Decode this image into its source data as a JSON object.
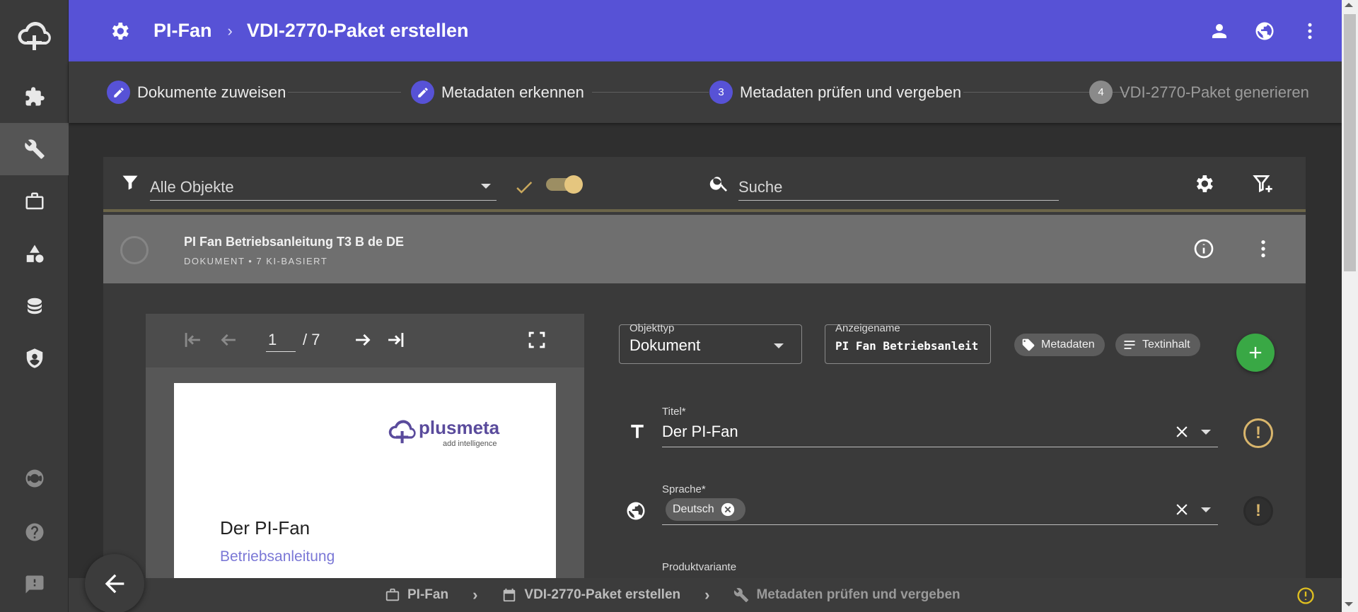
{
  "header": {
    "crumb_app": "PI-Fan",
    "crumb_separator": "›",
    "crumb_page": "VDI-2770-Paket erstellen"
  },
  "sidebar": {
    "items": [
      {
        "icon": "puzzle-icon"
      },
      {
        "icon": "wrench-icon",
        "active": true
      },
      {
        "icon": "briefcase-icon"
      },
      {
        "icon": "shapes-icon"
      },
      {
        "icon": "database-icon"
      },
      {
        "icon": "shield-icon"
      },
      {
        "icon": "lifebuoy-icon"
      },
      {
        "icon": "help-icon"
      },
      {
        "icon": "feedback-icon"
      }
    ]
  },
  "stepper": {
    "steps": [
      {
        "label": "Dokumente zuweisen",
        "state": "done"
      },
      {
        "label": "Metadaten erkennen",
        "state": "done"
      },
      {
        "number": "3",
        "label": "Metadaten prüfen und vergeben",
        "state": "active"
      },
      {
        "number": "4",
        "label": "VDI-2770-Paket generieren",
        "state": "disabled"
      }
    ]
  },
  "toolbar": {
    "filter_value": "Alle Objekte",
    "search_placeholder": "Suche"
  },
  "document": {
    "title": "PI Fan Betriebsanleitung T3 B de DE",
    "subtitle": "DOKUMENT • 7 KI-BASIERT"
  },
  "viewer": {
    "page_current": "1",
    "page_total": "/ 7",
    "page_logo_word": "plusmeta",
    "page_logo_tagline": "add intelligence",
    "page_heading": "Der PI-Fan",
    "page_subheading": "Betriebsanleitung"
  },
  "form": {
    "objecttype_label": "Objekttyp",
    "objecttype_value": "Dokument",
    "displayname_label": "Anzeigename",
    "displayname_value": "PI Fan Betriebsanleit",
    "chip_metadata": "Metadaten",
    "chip_textcontent": "Textinhalt",
    "title_label": "Titel*",
    "title_value": "Der PI-Fan",
    "language_label": "Sprache*",
    "language_chip": "Deutsch",
    "variant_label": "Produktvariante"
  },
  "bottombar": {
    "crumb1": "PI-Fan",
    "crumb2": "VDI-2770-Paket erstellen",
    "crumb3": "Metadaten prüfen und vergeben",
    "separator": "›"
  },
  "colors": {
    "brand": "#5752d6",
    "success": "#39a845",
    "warning": "#d8b56c"
  }
}
